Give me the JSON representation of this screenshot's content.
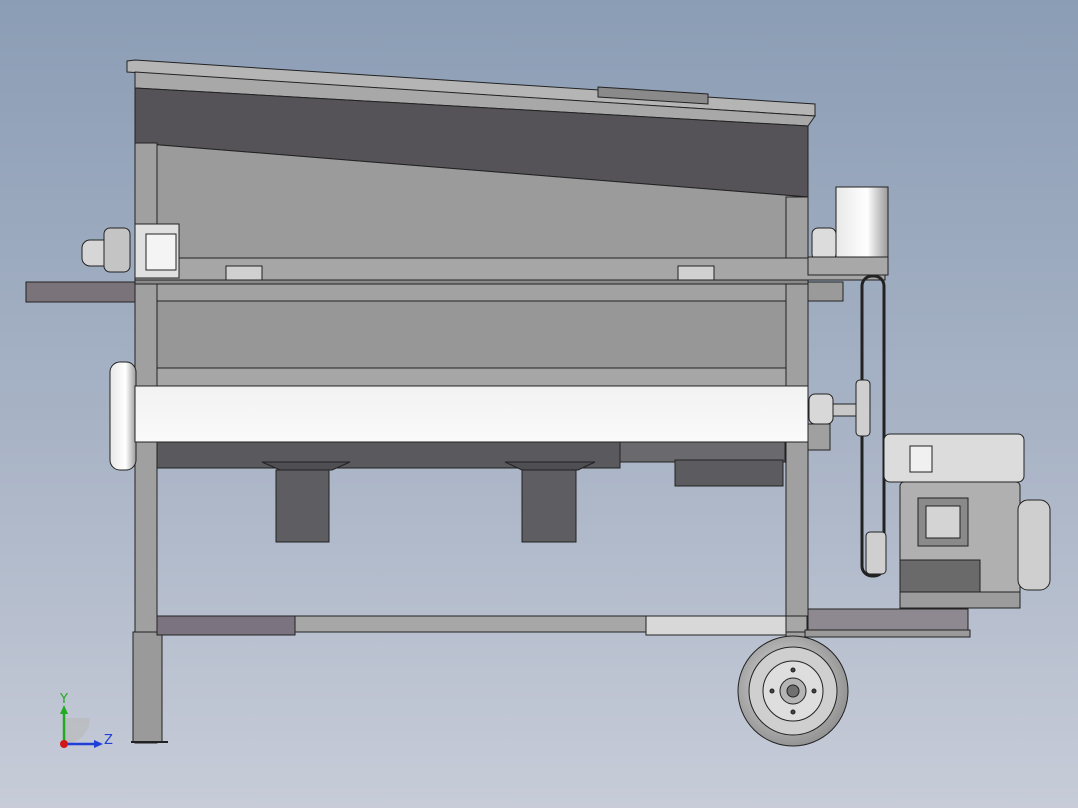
{
  "scene": {
    "view": "side-elevation",
    "background_top": "#8b9db5",
    "background_bottom": "#c7ccd8",
    "body_color": "#9b9b9b",
    "dark_panel_color": "#555358",
    "outline_color": "#222222"
  },
  "triad": {
    "y_label": "Y",
    "z_label": "Z",
    "y_color": "#22aa22",
    "z_color": "#1f3fd6",
    "origin_color": "#d01818"
  }
}
